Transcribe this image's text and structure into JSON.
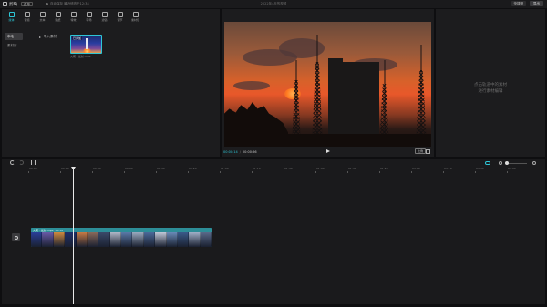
{
  "titlebar": {
    "app_name": "剪映",
    "menu_label": "菜单",
    "autosave_text": "自动保存 最近修改于12:34",
    "doc_title": "2022年4月的视频",
    "shortcut_label": "快捷键",
    "export_label": "导出"
  },
  "media_toolbar": [
    {
      "label": "媒体",
      "icon": "media-icon"
    },
    {
      "label": "音频",
      "icon": "audio-icon"
    },
    {
      "label": "文本",
      "icon": "text-icon"
    },
    {
      "label": "贴纸",
      "icon": "sticker-icon"
    },
    {
      "label": "特效",
      "icon": "effects-icon"
    },
    {
      "label": "转场",
      "icon": "transition-icon"
    },
    {
      "label": "滤镜",
      "icon": "filter-icon"
    },
    {
      "label": "调节",
      "icon": "adjust-icon"
    },
    {
      "label": "素材包",
      "icon": "package-icon"
    }
  ],
  "media_nav": {
    "local": "本地",
    "library": "素材库"
  },
  "media_folder": {
    "label": "导入素材"
  },
  "media_thumb": {
    "badge": "已添加",
    "caption": "火箭 · 发射.mp4"
  },
  "player": {
    "time_current": "00:00:14",
    "time_total": "00:00:56",
    "ratio_label": "比例"
  },
  "right_panel": {
    "line1": "点击轨道中的素材",
    "line2": "进行素材编辑"
  },
  "timeline": {
    "ticks": [
      "00:00",
      "00:10",
      "00:20",
      "00:30",
      "00:40",
      "00:50",
      "01:00",
      "01:10",
      "01:20",
      "01:30",
      "01:40",
      "01:50",
      "02:00",
      "02:10",
      "02:20",
      "02:30"
    ],
    "clip_name": "火箭 · 发射.mp4",
    "clip_duration": "00:56"
  },
  "colors": {
    "accent": "#2ec6d6",
    "panel": "#1c1c1e",
    "background": "#0e0e10",
    "clip": "#1f6f7a"
  }
}
